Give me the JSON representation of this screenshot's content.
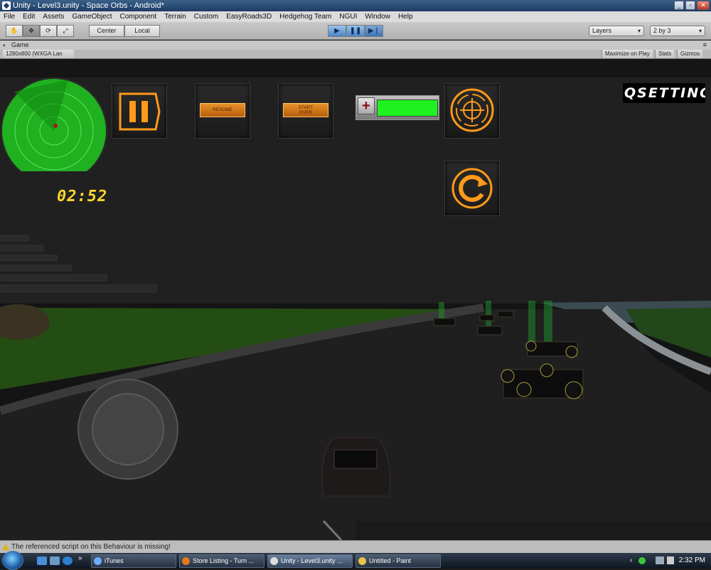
{
  "window": {
    "title": "Unity - Level3.unity - Space Orbs - Android*"
  },
  "menubar": [
    "File",
    "Edit",
    "Assets",
    "GameObject",
    "Component",
    "Terrain",
    "Custom",
    "EasyRoads3D",
    "Hedgehog Team",
    "NGUI",
    "Window",
    "Help"
  ],
  "toolbar": {
    "pivot_center": "Center",
    "pivot_local": "Local",
    "layers": "Layers",
    "layout": "2 by 3"
  },
  "game_tab": {
    "title": "Game",
    "resolution": "1280x800 (WXGA Lan",
    "maximize": "Maximize on Play",
    "stats": "Stats",
    "gizmos": "Gizmos"
  },
  "hud": {
    "timer": "02:52",
    "resume": "RESUME",
    "start_over_line1": "START",
    "start_over_line2": "OVER",
    "settings": "QSETTINGS",
    "health_fraction": 1.0,
    "colors": {
      "accent": "#ff9a1a",
      "radar": "#1fb11f",
      "health": "#1ef21e",
      "timer": "#ffd52e"
    }
  },
  "statusbar": {
    "message": "The referenced script on this Behaviour is missing!"
  },
  "taskbar": {
    "buttons": [
      {
        "label": "iTunes"
      },
      {
        "label": "Store Listing - Turn ..."
      },
      {
        "label": "Unity - Level3.unity ..."
      },
      {
        "label": "Untitled - Paint"
      }
    ],
    "clock": "2:32 PM"
  },
  "icons": {
    "hand_tool": "hand-icon",
    "move_tool": "move-icon",
    "rotate_tool": "rotate-icon",
    "scale_tool": "scale-icon",
    "play": "play-icon",
    "pause": "pause-icon",
    "step": "step-icon",
    "crosshair": "crosshair-icon",
    "restart": "restart-icon",
    "warning": "warning-icon"
  }
}
